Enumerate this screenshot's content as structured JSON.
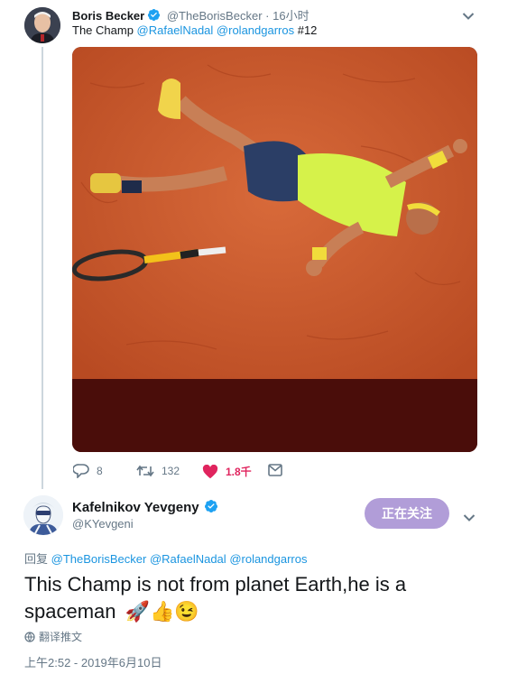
{
  "tweet": {
    "author_name": "Boris Becker",
    "author_handle": "@TheBorisBecker",
    "separator": "·",
    "time": "16小时",
    "text_plain": "The Champ ",
    "mention1": "@RafaelNadal",
    "mention2": "@rolandgarros",
    "hashtag_text": " #12",
    "actions": {
      "replies": "8",
      "retweets": "132",
      "likes": "1.8千"
    },
    "colors": {
      "like": "#e0245e",
      "link": "#1b95e0"
    }
  },
  "reply": {
    "author_name": "Kafelnikov Yevgeny",
    "author_handle": "@KYevgeni",
    "follow_label": "正在关注",
    "reply_prefix": "回复 ",
    "reply_to1": "@TheBorisBecker",
    "reply_to2": "@RafaelNadal",
    "reply_to3": "@rolandgarros",
    "text": "This Champ is not from planet Earth,he is a spaceman",
    "emojis": "🚀👍😉",
    "translate_label": "翻译推文",
    "timestamp": "上午2:52 - 2019年6月10日",
    "colors": {
      "follow_bg": "#b19dd8"
    }
  }
}
